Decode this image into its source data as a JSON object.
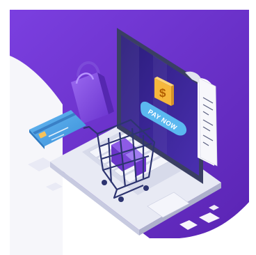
{
  "illustration": {
    "pay_button_label": "PAY NOW",
    "currency_symbol": "$",
    "icons": [
      "shopping-bag-icon",
      "credit-card-icon",
      "laptop-icon",
      "shopping-cart-icon",
      "receipt-icon",
      "coin-icon"
    ],
    "colors": {
      "background": "#ffffff",
      "brand_purple": "#6a2fc4",
      "deep_purple": "#4a1d9e",
      "light_purple": "#8c5ae6",
      "card_blue": "#4fa3e8",
      "coin_gold": "#f6b73c",
      "pay_button": "#5bb8f0"
    }
  }
}
